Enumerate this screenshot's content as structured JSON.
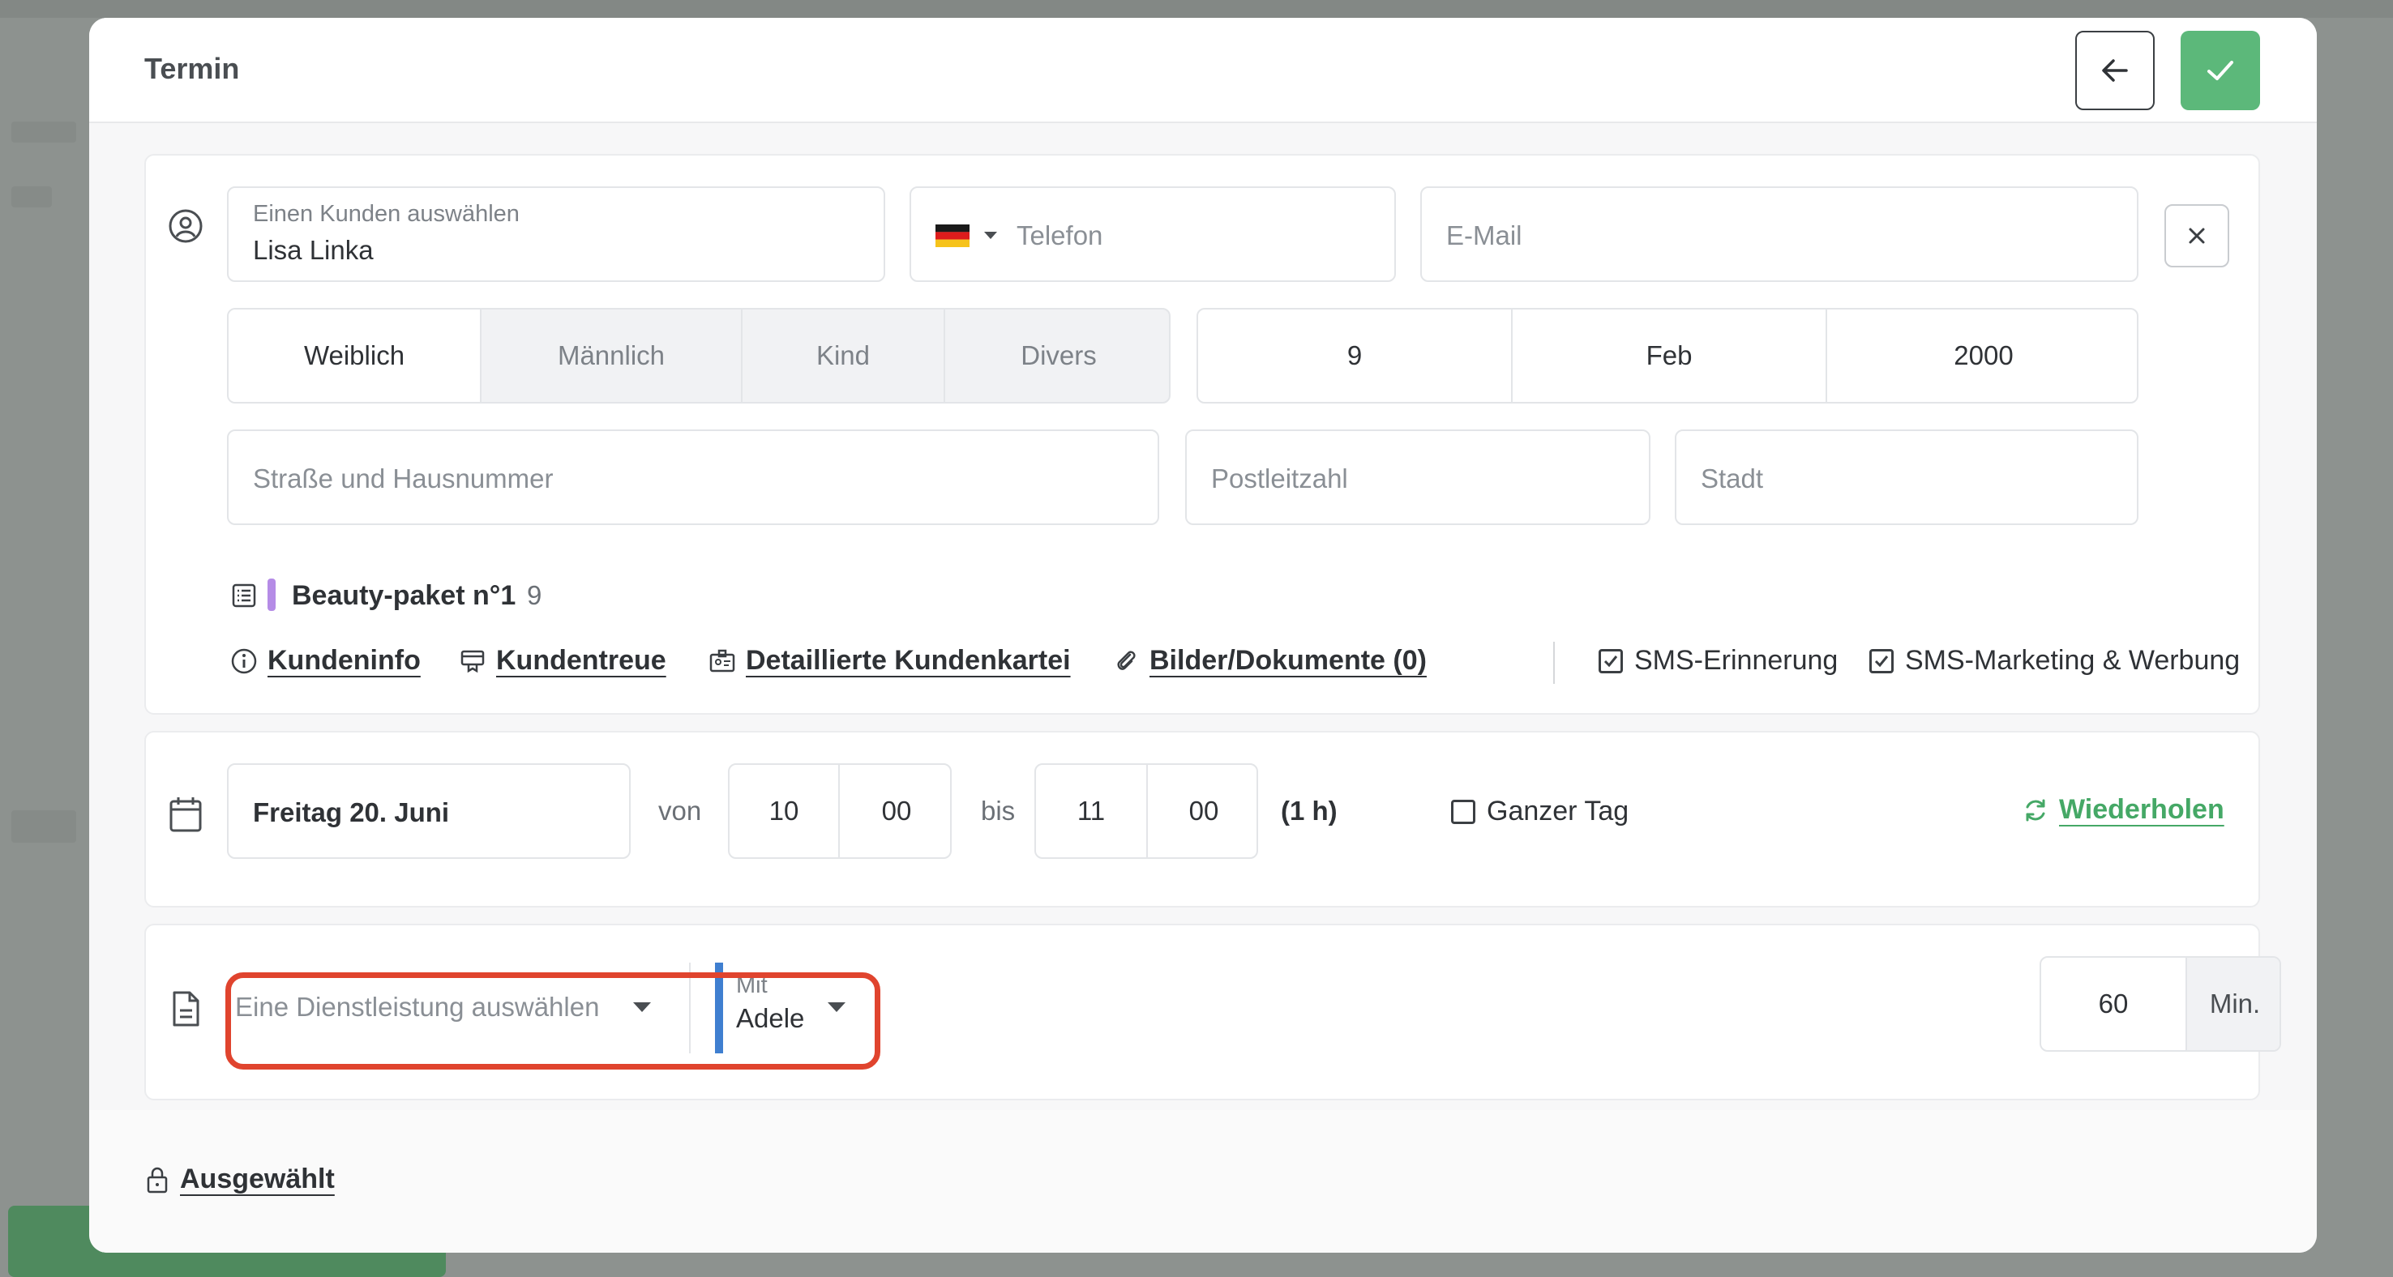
{
  "modal": {
    "title": "Termin"
  },
  "client": {
    "select_label": "Einen Kunden auswählen",
    "name": "Lisa Linka",
    "phone_placeholder": "Telefon",
    "email_placeholder": "E-Mail",
    "gender_options": [
      "Weiblich",
      "Männlich",
      "Kind",
      "Divers"
    ],
    "gender_selected": "Weiblich",
    "birth_day": "9",
    "birth_month": "Feb",
    "birth_year": "2000",
    "street_placeholder": "Straße und Hausnummer",
    "zip_placeholder": "Postleitzahl",
    "city_placeholder": "Stadt",
    "package_name": "Beauty-paket n°1",
    "package_count": "9",
    "package_color": "#b58ce6",
    "links": {
      "info": "Kundeninfo",
      "loyalty": "Kundentreue",
      "file": "Detaillierte Kundenkartei",
      "docs": "Bilder/Dokumente (0)"
    },
    "sms_reminder": "SMS-Erinnerung",
    "sms_marketing": "SMS-Marketing & Werbung"
  },
  "schedule": {
    "date": "Freitag 20. Juni",
    "from_label": "von",
    "from_hour": "10",
    "from_min": "00",
    "to_label": "bis",
    "to_hour": "11",
    "to_min": "00",
    "duration": "(1 h)",
    "all_day": "Ganzer Tag",
    "repeat": "Wiederholen"
  },
  "service": {
    "placeholder": "Eine Dienstleistung auswählen",
    "with_label": "Mit",
    "staff": "Adele",
    "staff_color": "#3f7fd0",
    "minutes": "60",
    "minutes_unit": "Min."
  },
  "footer": {
    "lock_label": "Ausgewählt"
  },
  "colors": {
    "accent_green": "#5cb87a",
    "highlight_red": "#e0442e"
  }
}
